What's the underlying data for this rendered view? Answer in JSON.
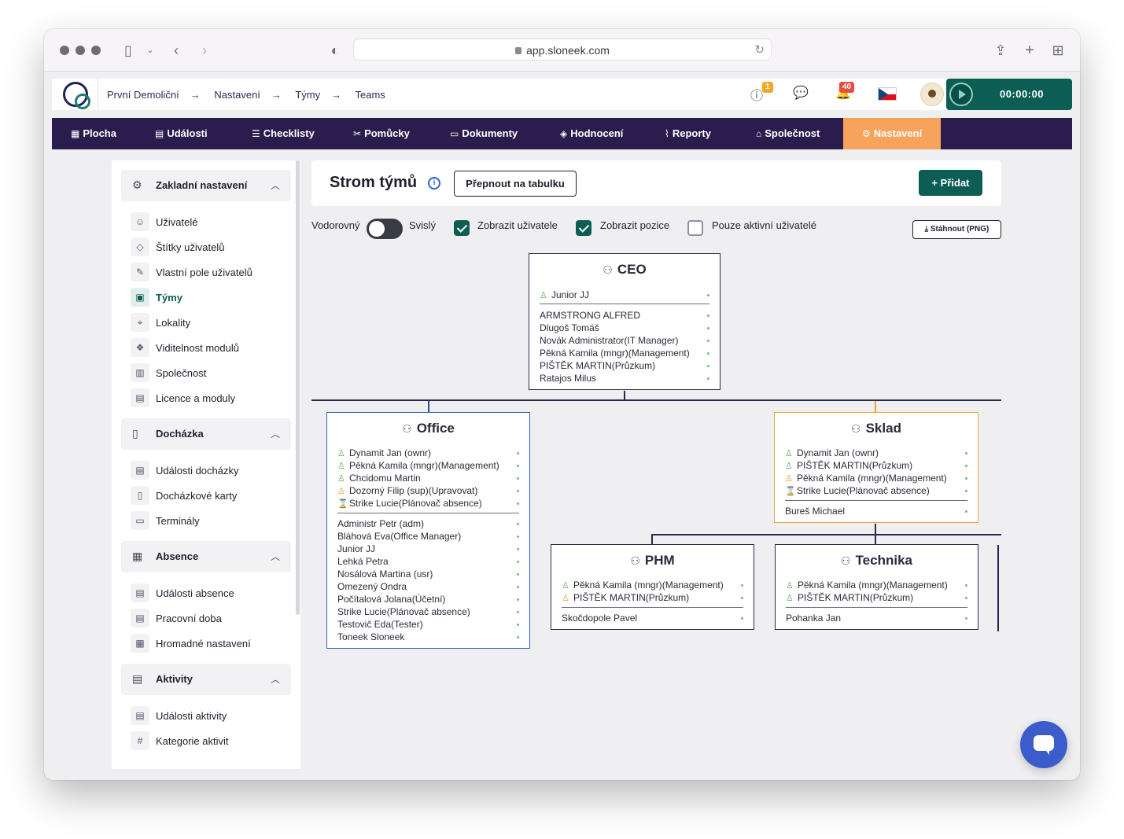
{
  "browser": {
    "url": "app.sloneek.com"
  },
  "breadcrumb": [
    "První Demoliční",
    "Nastavení",
    "Týmy",
    "Teams"
  ],
  "header": {
    "alerts_badge": "1",
    "notifications_badge": "40",
    "timer": "00:00:00"
  },
  "nav": [
    {
      "label": "Plocha",
      "icon": "▦"
    },
    {
      "label": "Události",
      "icon": "▤"
    },
    {
      "label": "Checklisty",
      "icon": "☰"
    },
    {
      "label": "Pomůcky",
      "icon": "✂"
    },
    {
      "label": "Dokumenty",
      "icon": "▭"
    },
    {
      "label": "Hodnocení",
      "icon": "◈"
    },
    {
      "label": "Reporty",
      "icon": "⌇"
    },
    {
      "label": "Společnost",
      "icon": "⌂"
    },
    {
      "label": "Nastavení",
      "icon": "⚙"
    }
  ],
  "sidebar": {
    "sections": [
      {
        "title": "Zakladní nastavení",
        "items": [
          "Uživatelé",
          "Štítky uživatelů",
          "Vlastní pole uživatelů",
          "Týmy",
          "Lokality",
          "Viditelnost modulů",
          "Společnost",
          "Licence a moduly"
        ]
      },
      {
        "title": "Docházka",
        "items": [
          "Události docházky",
          "Docházkové karty",
          "Terminály"
        ]
      },
      {
        "title": "Absence",
        "items": [
          "Události absence",
          "Pracovní doba",
          "Hromadné nastavení"
        ]
      },
      {
        "title": "Aktivity",
        "items": [
          "Události aktivity",
          "Kategorie aktivit"
        ]
      }
    ],
    "active_item": "Týmy"
  },
  "page": {
    "title": "Strom týmů",
    "switch_button": "Přepnout na tabulku",
    "add_button": "+ Přidat",
    "orientation_left": "Vodorovný",
    "orientation_right": "Svislý",
    "show_users": "Zobrazit uživatele",
    "show_positions": "Zobrazit pozice",
    "only_active": "Pouze aktivní uživatelé",
    "download_button": "Stáhnout (PNG)"
  },
  "tree": {
    "ceo": {
      "name": "CEO",
      "leads": [
        {
          "icon": "g",
          "text": "Junior JJ"
        }
      ],
      "members": [
        "ARMSTRONG ALFRED",
        "Dlugoš Tomáš",
        "Novák Administrator(IT Manager)",
        "Pěkná Kamila (mngr)(Management)",
        "PIŠTĚK MARTIN(Průzkum)",
        "Ratajos Milus"
      ]
    },
    "office": {
      "name": "Office",
      "leads": [
        {
          "icon": "g",
          "text": "Dynamit Jan (ownr)"
        },
        {
          "icon": "g",
          "text": "Pěkná Kamila (mngr)(Management)"
        },
        {
          "icon": "g",
          "text": "Chcidomu Martin"
        },
        {
          "icon": "o",
          "text": "Dozorný Filip (sup)(Upravovat)"
        },
        {
          "icon": "r",
          "text": "Strike Lucie(Plánovač absence)"
        }
      ],
      "members": [
        "Administr Petr (adm)",
        "Bláhová Eva(Office Manager)",
        "Junior JJ",
        "Lehká Petra",
        "Nosálová Martina (usr)",
        "Omezený Ondra",
        "Počítalová Jolana(Účetní)",
        "Strike Lucie(Plánovač absence)",
        "Testovič Eda(Tester)",
        "Toneek Sloneek"
      ]
    },
    "sklad": {
      "name": "Sklad",
      "leads": [
        {
          "icon": "g",
          "text": "Dynamit Jan (ownr)"
        },
        {
          "icon": "g",
          "text": "PIŠTĚK MARTIN(Průzkum)"
        },
        {
          "icon": "o",
          "text": "Pěkná Kamila (mngr)(Management)"
        },
        {
          "icon": "r",
          "text": "Strike Lucie(Plánovač absence)"
        }
      ],
      "members": [
        "Bureš Michael"
      ]
    },
    "phm": {
      "name": "PHM",
      "leads": [
        {
          "icon": "g",
          "text": "Pěkná Kamila (mngr)(Management)"
        },
        {
          "icon": "o",
          "text": "PIŠTĚK MARTIN(Průzkum)"
        }
      ],
      "members": [
        "Skočdopole Pavel"
      ]
    },
    "technika": {
      "name": "Technika",
      "leads": [
        {
          "icon": "g",
          "text": "Pěkná Kamila (mngr)(Management)"
        },
        {
          "icon": "g",
          "text": "PIŠTĚK MARTIN(Průzkum)"
        }
      ],
      "members": [
        "Pohanka Jan"
      ]
    }
  }
}
